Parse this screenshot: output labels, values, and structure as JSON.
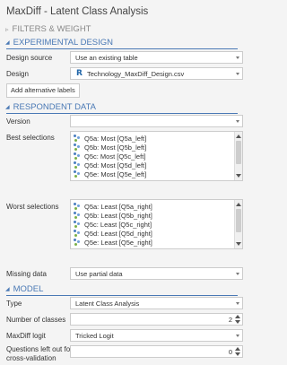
{
  "title": "MaxDiff - Latent Class Analysis",
  "sections": {
    "filters": "FILTERS & WEIGHT",
    "experimental": "EXPERIMENTAL DESIGN",
    "respondent": "RESPONDENT DATA",
    "model": "MODEL"
  },
  "design_source": {
    "label": "Design source",
    "value": "Use an existing table"
  },
  "design": {
    "label": "Design",
    "value": "Technology_MaxDiff_Design.csv",
    "icon": "r-logo-icon"
  },
  "add_alt_labels": "Add alternative labels",
  "version": {
    "label": "Version",
    "value": ""
  },
  "best": {
    "label": "Best selections",
    "items": [
      "Q5a: Most [Q5a_left]",
      "Q5b: Most [Q5b_left]",
      "Q5c: Most [Q5c_left]",
      "Q5d: Most [Q5d_left]",
      "Q5e: Most [Q5e_left]"
    ]
  },
  "worst": {
    "label": "Worst selections",
    "items": [
      "Q5a: Least [Q5a_right]",
      "Q5b: Least [Q5b_right]",
      "Q5c: Least [Q5c_right]",
      "Q5d: Least [Q5d_right]",
      "Q5e: Least [Q5e_right]"
    ]
  },
  "missing": {
    "label": "Missing data",
    "value": "Use partial data"
  },
  "type": {
    "label": "Type",
    "value": "Latent Class Analysis"
  },
  "classes": {
    "label": "Number of classes",
    "value": "2"
  },
  "logit": {
    "label": "MaxDiff logit",
    "value": "Tricked Logit"
  },
  "questions_out": {
    "label": "Questions left out for cross-validation",
    "value": "0"
  },
  "colors": {
    "accent": "#4a79b5",
    "section_muted": "#888888"
  }
}
